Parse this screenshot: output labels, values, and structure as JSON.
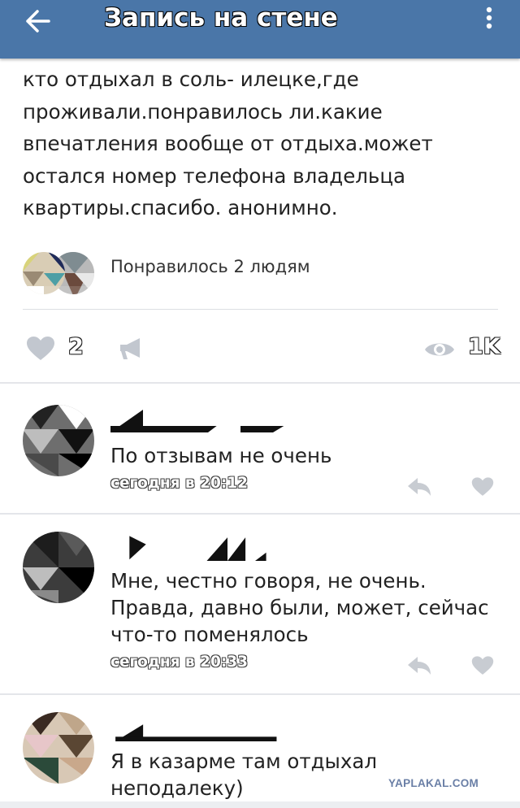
{
  "header": {
    "title": "Запись на стене",
    "back_icon": "arrow-left-icon",
    "menu_icon": "more-vertical-icon",
    "background": "#4a76a8"
  },
  "post": {
    "lines": [
      "кто отдыхал в соль- илецке,где",
      "проживали.понравилось ли.какие",
      "впечатления вообще от отдыха.может",
      "остался номер телефона владельца",
      "квартиры.спасибо. анонимно."
    ],
    "liked_by_text": "Понравилось 2 людям"
  },
  "actions": {
    "like_icon": "heart-icon",
    "like_count": "2",
    "share_icon": "megaphone-icon",
    "views_icon": "eye-icon",
    "views_count": "1K"
  },
  "comments": [
    {
      "name": "",
      "text_lines": [
        "По отзывам не очень"
      ],
      "time": "сегодня в 20:12"
    },
    {
      "name": "",
      "text_lines": [
        "Мне, честно говоря, не очень.",
        "Правда, давно были, может, сейчас",
        "что-то поменялось"
      ],
      "time": "сегодня в 20:33"
    },
    {
      "name": "",
      "text_lines": [
        "Я в казарме там отдыхал",
        "неподалеку)"
      ],
      "time": ""
    }
  ],
  "watermark": "YAPLAKAL.COM"
}
